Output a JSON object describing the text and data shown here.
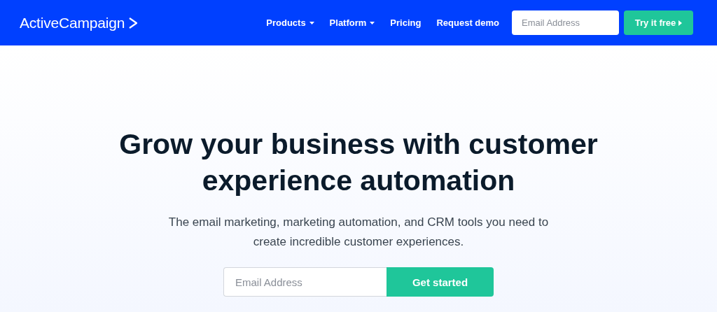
{
  "header": {
    "logo": "ActiveCampaign",
    "nav": [
      {
        "label": "Products",
        "dropdown": true
      },
      {
        "label": "Platform",
        "dropdown": true
      },
      {
        "label": "Pricing",
        "dropdown": false
      },
      {
        "label": "Request demo",
        "dropdown": false
      }
    ],
    "email": {
      "placeholder": "Email Address"
    },
    "cta": "Try it free"
  },
  "hero": {
    "headline": "Grow your business with customer experience automation",
    "subtitle": "The email marketing, marketing automation, and CRM tools you need to create incredible customer experiences.",
    "email": {
      "placeholder": "Email Address"
    },
    "cta": "Get started"
  }
}
